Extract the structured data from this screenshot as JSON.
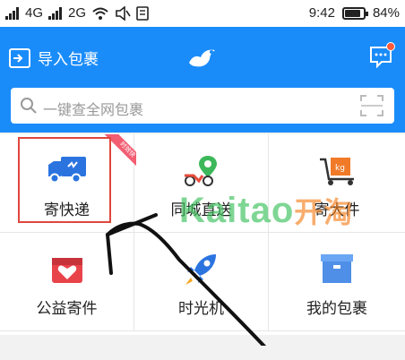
{
  "status_bar": {
    "net1": "4G",
    "net2": "2G",
    "time": "9:42",
    "battery_percent": "84%",
    "battery_level": 0.84
  },
  "header": {
    "import_label": "导入包裹",
    "search_placeholder": "一键查全网包裹",
    "bg_color": "#1a8cfa"
  },
  "grid": {
    "items": [
      {
        "label": "寄快递",
        "icon": "truck-icon"
      },
      {
        "label": "同城直送",
        "icon": "map-pin-scooter-icon"
      },
      {
        "label": "寄大件",
        "icon": "big-package-cart-icon"
      },
      {
        "label": "公益寄件",
        "icon": "heart-box-icon"
      },
      {
        "label": "时光机",
        "icon": "rocket-icon"
      },
      {
        "label": "我的包裹",
        "icon": "package-box-icon"
      }
    ],
    "ribbon_text": "时效快"
  },
  "watermark": {
    "latin": "Kaitao",
    "cn": "开淘"
  }
}
